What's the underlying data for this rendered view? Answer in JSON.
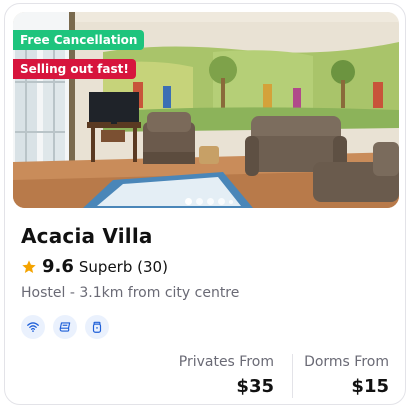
{
  "property": {
    "name": "Acacia Villa",
    "badges": {
      "free_cancellation": "Free Cancellation",
      "selling_out": "Selling out fast!"
    },
    "rating": {
      "score": "9.6",
      "text": "Superb (30)"
    },
    "subtitle": "Hostel - 3.1km from city centre",
    "facilities": [
      "wifi-icon",
      "linen-icon",
      "lock-icon"
    ],
    "image_carousel": {
      "active_index": 0,
      "dots": 5
    },
    "prices": {
      "privates": {
        "label": "Privates From",
        "value": "$35"
      },
      "dorms": {
        "label": "Dorms From",
        "value": "$15"
      }
    }
  },
  "colors": {
    "free_badge": "#1ec47d",
    "selling_badge": "#d7153d",
    "star": "#f4a300",
    "facility_icon": "#1e5fd8"
  }
}
